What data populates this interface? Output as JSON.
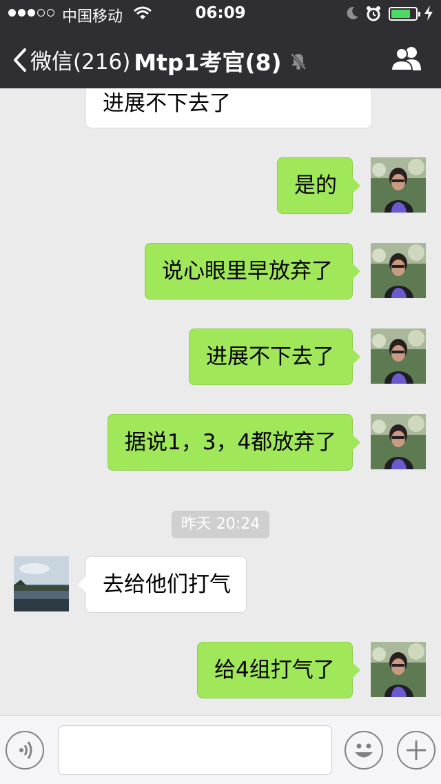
{
  "status_bar": {
    "carrier": "中国移动",
    "time": "06:09",
    "signal_bars_filled": 3,
    "signal_bars_total": 5,
    "battery_level": 0.75
  },
  "nav": {
    "back_label": "微信(216)",
    "title": "Mtp1考官(8)",
    "icons": [
      "chevron-left-icon",
      "mute-bell-icon",
      "group-contacts-icon"
    ]
  },
  "chat": {
    "messages": [
      {
        "direction": "in",
        "text": "进展不下去了"
      },
      {
        "direction": "out",
        "text": "是的"
      },
      {
        "direction": "out",
        "text": "说心眼里早放弃了"
      },
      {
        "direction": "out",
        "text": "进展不下去了"
      },
      {
        "direction": "out",
        "text": "据说1，3，4都放弃了"
      },
      {
        "direction": "in",
        "text": "去给他们打气"
      },
      {
        "direction": "out",
        "text": "给4组打气了"
      }
    ],
    "timestamp": "昨天 20:24"
  },
  "input_bar": {
    "text_value": "",
    "icons": [
      "voice-icon",
      "emoji-icon",
      "plus-icon"
    ]
  },
  "colors": {
    "nav_bg": "#2e2e33",
    "chat_bg": "#ebebeb",
    "outgoing_bubble": "#a0e75a",
    "incoming_bubble": "#ffffff",
    "battery": "#4cd964"
  }
}
